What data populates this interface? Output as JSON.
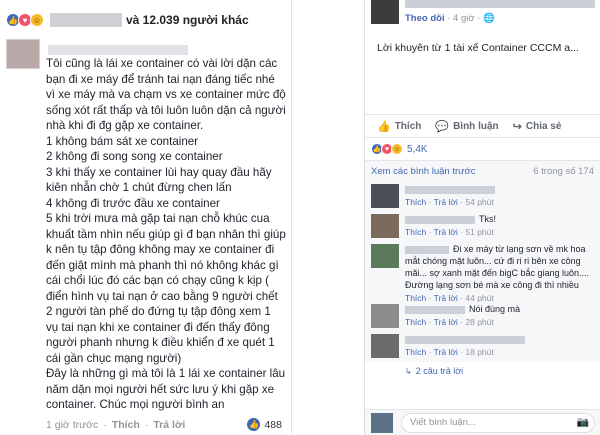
{
  "left": {
    "reactions": {
      "icons": [
        "like-icon",
        "heart-icon",
        "wow-icon"
      ],
      "suffix": "và 12.039 người khác"
    },
    "post_lines": [
      "Tôi cũng là lái xe container có vài lời dặn các bạn đi xe máy để tránh tai nạn đáng tiếc nhé vì xe máy mà va chạm vs xe container mức độ sống xót rất thấp và tôi luôn luôn dặn cả người nhà khi đi đg gặp xe container.",
      "1 không bám sát xe container",
      "2 không đi song song xe container",
      "3 khi thấy xe container lùi hay quay đầu hãy kiên nhẫn chờ 1 chút đừng chen lấn",
      "4 không đi trước đầu xe container",
      "5 khi trời mưa mà gặp tai nạn chỗ khúc cua khuất tầm nhìn nếu giúp gì đ bạn nhân thì giúp k nên tụ tập đông không may xe container đi đến giật mình mà phanh thì nó không khác gì cái chổi lúc đó các bạn có chạy cũng k kịp ( điển hình vụ tai nạn ở cao bằng 9 người chết 2 người tàn phế do đứng tụ tập đông xem 1 vụ tai nạn khi xe container đi đến thấy đông người phanh nhưng k điều khiển đ xe quét 1 cái gần chục mạng người)",
      "Đây là những gì mà tôi là 1 lái xe container lâu năm dặn mọi người hết sức lưu ý khi gặp xe container. Chúc mọi người bình an"
    ],
    "footer": {
      "time": "1 giờ trước",
      "like": "Thích",
      "reply": "Trả lời",
      "count": "488"
    }
  },
  "right": {
    "meta": {
      "follow": "Theo dõi",
      "time": "4 giờ"
    },
    "headline": "Lời khuyên từ 1 tài xế Container CCCM a...",
    "actions": {
      "like": "Thích",
      "comment": "Bình luận",
      "share": "Chia sẻ"
    },
    "reaction_count": "5,4K",
    "view_more": "Xem các bình luận trước",
    "of_count": "6 trong số 174",
    "comments": [
      {
        "text": "",
        "time": "54 phút",
        "av_color": "#4a4f57",
        "name_w": 90
      },
      {
        "text": "Tks!",
        "time": "51 phút",
        "av_color": "#7a6b5c",
        "name_w": 70
      },
      {
        "text": "Đi xe máy từ lạng sơn về mk hoa mắt chóng mặt luôn... cứ đi ri ri bên xe công mãi... sợ xanh mặt đến bigC bắc giang luôn.... Đường lạng sơn bé mà xe công đi thì nhiều",
        "time": "44 phút",
        "av_color": "#5a7a5a",
        "name_w": 44
      },
      {
        "text": "Nói đúng mà",
        "time": "28 phút",
        "av_color": "#8c8c8c",
        "name_w": 60
      },
      {
        "text": "",
        "time": "18 phút",
        "av_color": "#6b6b6b",
        "name_w": 120
      }
    ],
    "replies": "2 câu trả lời",
    "reply_like": "Thích",
    "reply_reply": "Trả lời",
    "write_placeholder": "Viết bình luận..."
  }
}
